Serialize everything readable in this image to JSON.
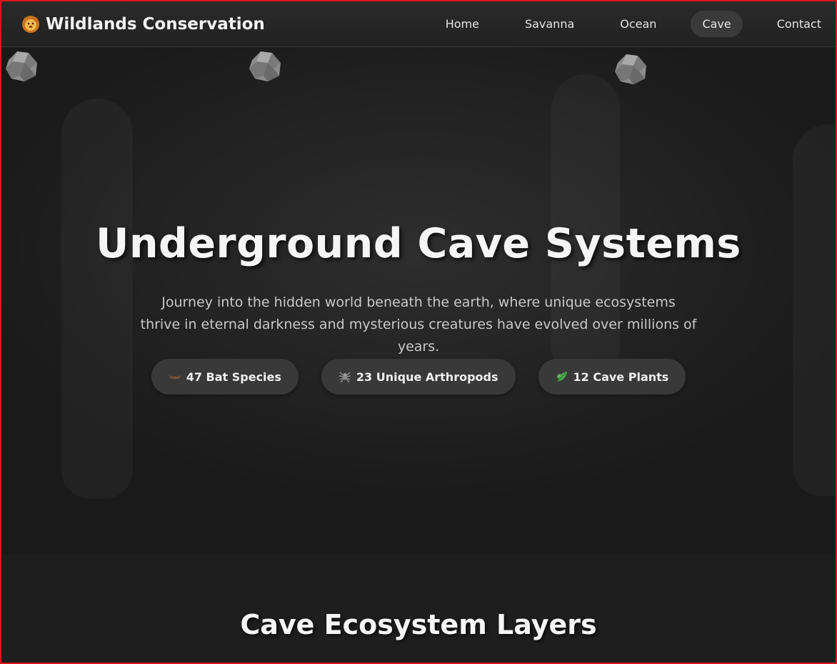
{
  "nav": {
    "brand": "Wildlands Conservation",
    "brand_icon": "lion-icon",
    "links": [
      {
        "label": "Home",
        "active": false
      },
      {
        "label": "Savanna",
        "active": false
      },
      {
        "label": "Ocean",
        "active": false
      },
      {
        "label": "Cave",
        "active": true
      },
      {
        "label": "Contact",
        "active": false
      }
    ]
  },
  "hero": {
    "title": "Underground Cave Systems",
    "description": "Journey into the hidden world beneath the earth, where unique ecosystems thrive in eternal darkness and mysterious creatures have evolved over millions of years.",
    "stats": [
      {
        "icon": "bat-icon",
        "label": "47 Bat Species"
      },
      {
        "icon": "spider-icon",
        "label": "23 Unique Arthropods"
      },
      {
        "icon": "leaf-icon",
        "label": "12 Cave Plants"
      }
    ]
  },
  "section": {
    "title": "Cave Ecosystem Layers"
  },
  "colors": {
    "border": "#e0141a",
    "nav_bg": "#262626",
    "hero_bg": "#232323",
    "pill_bg": "#393939",
    "text": "#f5f5f5"
  }
}
